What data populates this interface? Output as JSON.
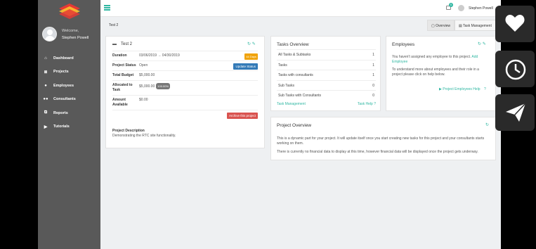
{
  "sidebar": {
    "welcome": "Welcome,",
    "user_name": "Stephen Powell",
    "items": [
      {
        "label": "Dashboard",
        "icon": "home-icon",
        "glyph": "⌂"
      },
      {
        "label": "Projects",
        "icon": "list-icon",
        "glyph": "≣"
      },
      {
        "label": "Employees",
        "icon": "user-icon",
        "glyph": "●"
      },
      {
        "label": "Consultants",
        "icon": "users-icon",
        "glyph": "●●"
      },
      {
        "label": "Reports",
        "icon": "reports-icon",
        "glyph": "⧉"
      },
      {
        "label": "Tutorials",
        "icon": "play-icon",
        "glyph": "▶"
      }
    ]
  },
  "topbar": {
    "notification_count": "0",
    "user_name": "Stephen Powell"
  },
  "subbar": {
    "title": "Test 2",
    "tabs": [
      "Overview",
      "Task Management"
    ]
  },
  "project": {
    "name": "Test 2",
    "fields": [
      {
        "key": "Duration",
        "value": "03/06/2019 → 04/30/2019",
        "badge": "44 Days"
      },
      {
        "key": "Project Status",
        "value": "Open",
        "button": "Update Status"
      },
      {
        "key": "Total Budget",
        "value": "$5,000.00"
      },
      {
        "key": "Allocated to Task",
        "value": "$5,000.00",
        "pct": "100.00%"
      },
      {
        "key": "Amount Available",
        "value": "$0.00"
      }
    ],
    "archive_button": "Archive this project",
    "description_label": "Project Description",
    "description": "Demonstrating the RTC site functionality."
  },
  "tasks": {
    "title": "Tasks Overview",
    "rows": [
      {
        "label": "All Tasks & Subtasks",
        "count": "1"
      },
      {
        "label": "Tasks",
        "count": "1"
      },
      {
        "label": "Tasks with consultants",
        "count": "1"
      },
      {
        "label": "Sub Tasks",
        "count": "0"
      },
      {
        "label": "Sub Tasks with Consultants",
        "count": "0"
      }
    ],
    "footer_left": "Task Management",
    "footer_right": "Task Help"
  },
  "employees": {
    "title": "Employees",
    "text1": "You haven't assigned any employee to this project.",
    "link": "Add Employee",
    "text2": "To understand more about employees and their role in a project please click on help below.",
    "help_link": "▶ Project Employees Help"
  },
  "overview": {
    "title": "Project Overview",
    "p1": "This is a dynamic part for your project. It will update itself once you start creating new tasks for this project and your consultants starts working on them.",
    "p2": "There is currently no financial data to display at this time, however financial data will be displayed once the project gets underway."
  },
  "colors": {
    "accent": "#2fb7a2",
    "sidebar": "#595959"
  }
}
